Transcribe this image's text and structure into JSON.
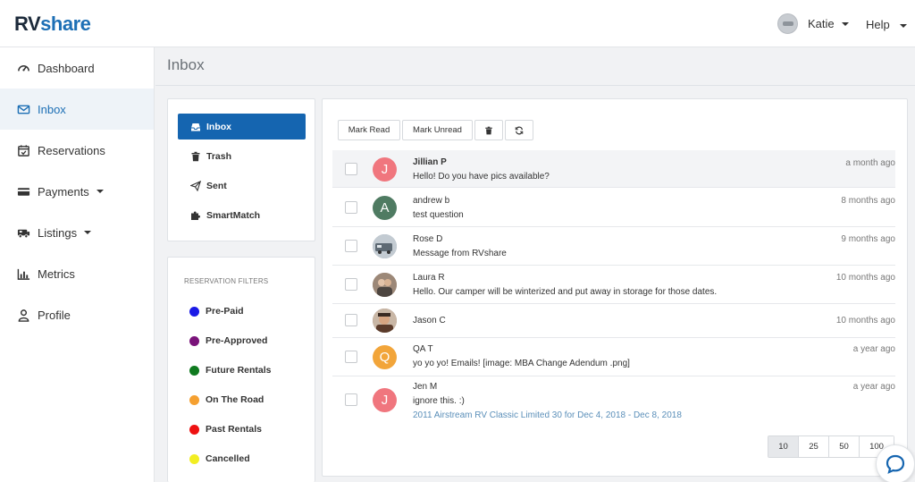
{
  "app": {
    "logo_part1": "RV",
    "logo_part2": "share",
    "brand_color": "#1d6fb5"
  },
  "header": {
    "user_name": "Katie",
    "help_label": "Help"
  },
  "sidebar": {
    "items": [
      {
        "label": "Dashboard",
        "icon": "dashboard-icon"
      },
      {
        "label": "Inbox",
        "icon": "envelope-icon",
        "active": true
      },
      {
        "label": "Reservations",
        "icon": "calendar-icon"
      },
      {
        "label": "Payments",
        "icon": "credit-card-icon"
      },
      {
        "label": "Listings",
        "icon": "rv-icon"
      },
      {
        "label": "Metrics",
        "icon": "bar-chart-icon"
      },
      {
        "label": "Profile",
        "icon": "user-icon"
      }
    ]
  },
  "page": {
    "title": "Inbox"
  },
  "folders": [
    {
      "label": "Inbox",
      "icon": "inbox-icon",
      "active": true
    },
    {
      "label": "Trash",
      "icon": "trash-icon"
    },
    {
      "label": "Sent",
      "icon": "paper-plane-icon"
    },
    {
      "label": "SmartMatch",
      "icon": "puzzle-icon"
    }
  ],
  "filters": {
    "title": "RESERVATION FILTERS",
    "items": [
      {
        "label": "Pre-Paid",
        "color": "#1a1ae6"
      },
      {
        "label": "Pre-Approved",
        "color": "#7a137a"
      },
      {
        "label": "Future Rentals",
        "color": "#0f7a1f"
      },
      {
        "label": "On The Road",
        "color": "#f5a030"
      },
      {
        "label": "Past Rentals",
        "color": "#ee1111"
      },
      {
        "label": "Cancelled",
        "color": "#f2ee22"
      }
    ]
  },
  "toolbar": {
    "mark_read": "Mark Read",
    "mark_unread": "Mark Unread"
  },
  "messages": [
    {
      "name": "Jillian P",
      "text": "Hello! Do you have pics available?",
      "time": "a month ago",
      "initial": "J",
      "avatar_color": "#f0767e",
      "unread": true
    },
    {
      "name": "andrew b",
      "text": "test question",
      "time": "8 months ago",
      "initial": "A",
      "avatar_color": "#4f7b62"
    },
    {
      "name": "Rose D",
      "text": "Message from RVshare",
      "time": "9 months ago",
      "initial": "",
      "avatar_color": "#8a9aa8"
    },
    {
      "name": "Laura R",
      "text": "Hello. Our camper will be winterized and put away in storage for those dates.",
      "time": "10 months ago",
      "initial": "",
      "avatar_color": "#b49a86"
    },
    {
      "name": "Jason C",
      "text": "",
      "time": "10 months ago",
      "initial": "",
      "avatar_color": "#8a6a5a"
    },
    {
      "name": "QA T",
      "text": "yo yo yo! Emails! [image: MBA Change Adendum .png]",
      "time": "a year ago",
      "initial": "Q",
      "avatar_color": "#f2a53a"
    },
    {
      "name": "Jen M",
      "text": "ignore this. :)",
      "subtext": "2011 Airstream RV Classic Limited 30 for Dec 4, 2018 - Dec 8, 2018",
      "time": "a year ago",
      "initial": "J",
      "avatar_color": "#f0767e"
    }
  ],
  "pagination": {
    "options": [
      "10",
      "25",
      "50",
      "100"
    ],
    "selected": "10"
  }
}
